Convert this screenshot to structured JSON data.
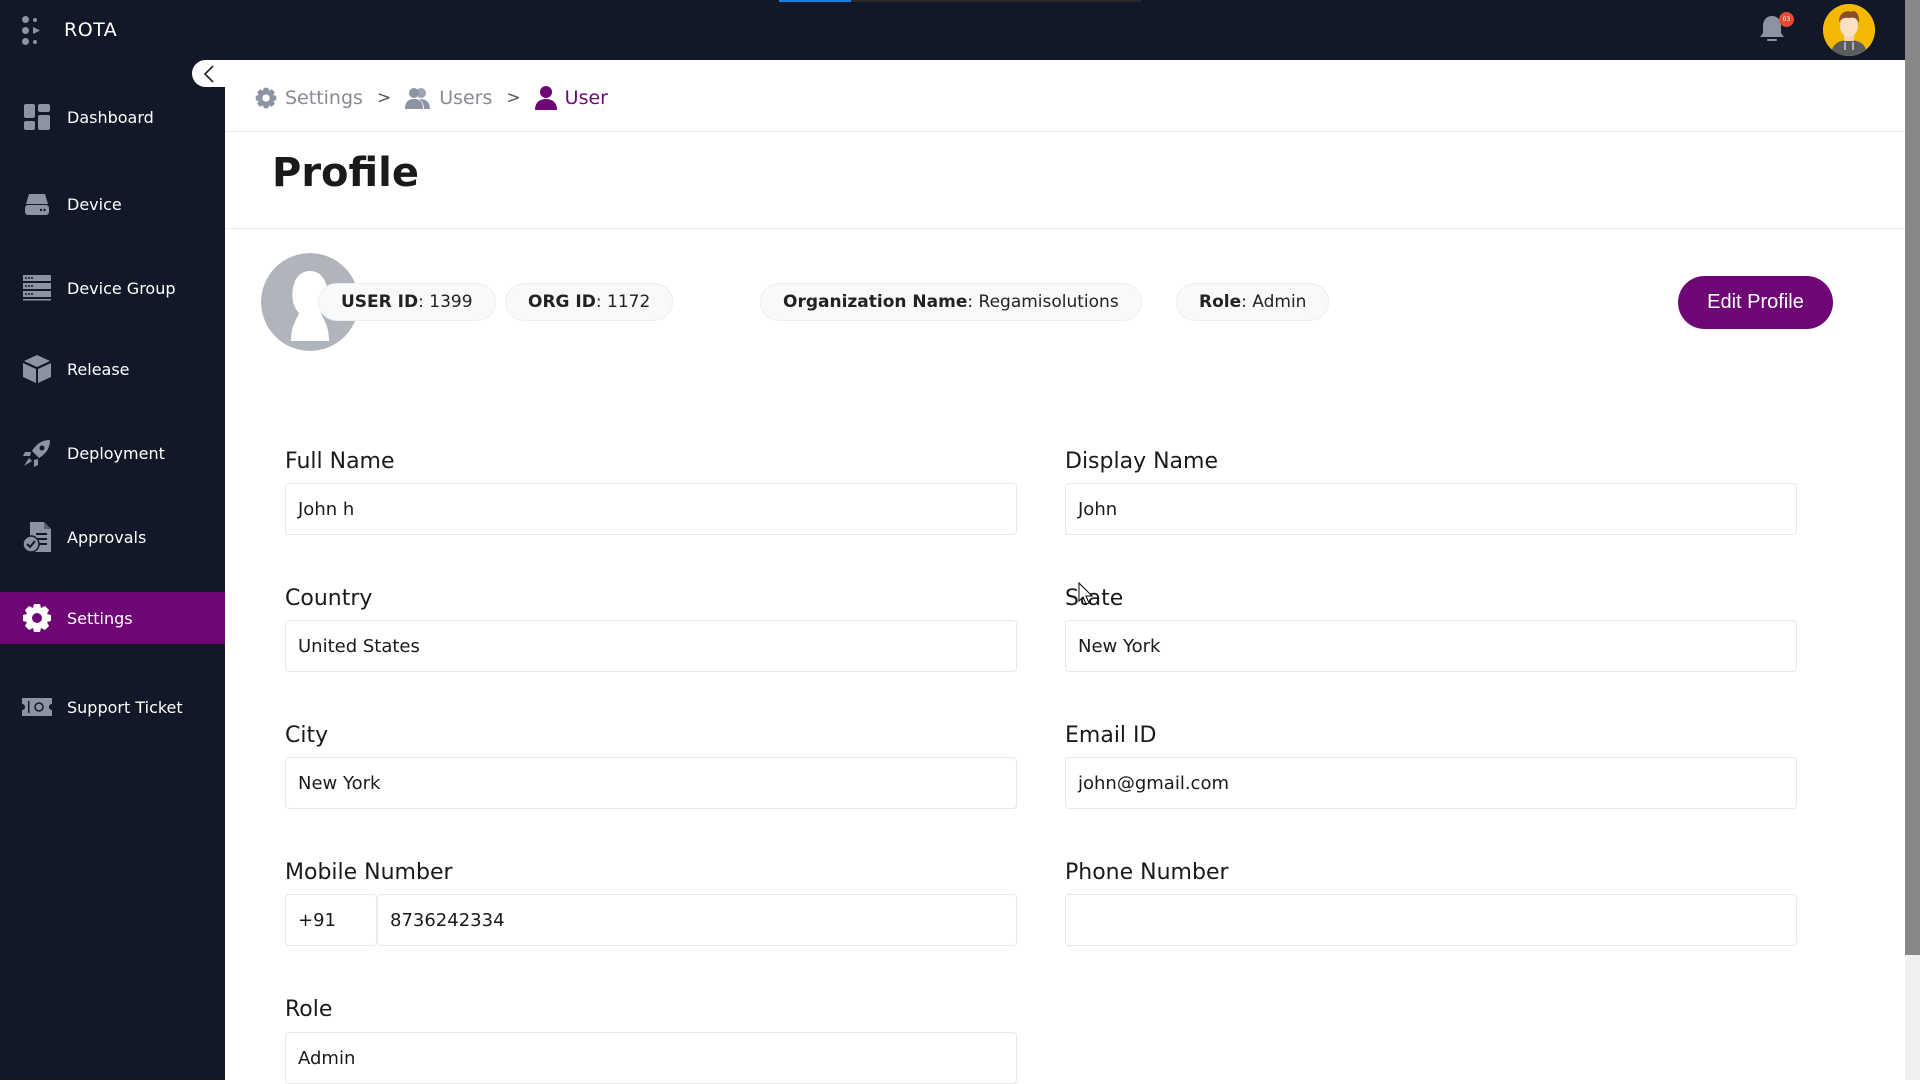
{
  "app": {
    "name": "ROTA",
    "notification_count": "03",
    "accent_color": "#6e0676"
  },
  "sidebar": {
    "items": [
      {
        "label": "Dashboard",
        "icon": "dashboard-icon",
        "active": false
      },
      {
        "label": "Device",
        "icon": "hard-drive-icon",
        "active": false
      },
      {
        "label": "Device Group",
        "icon": "server-rack-icon",
        "active": false
      },
      {
        "label": "Release",
        "icon": "package-box-icon",
        "active": false
      },
      {
        "label": "Deployment",
        "icon": "rocket-icon",
        "active": false
      },
      {
        "label": "Approvals",
        "icon": "document-check-icon",
        "active": false
      },
      {
        "label": "Settings",
        "icon": "gear-icon",
        "active": true
      },
      {
        "label": "Support Ticket",
        "icon": "ticket-icon",
        "active": false
      }
    ]
  },
  "breadcrumb": {
    "items": [
      {
        "label": "Settings",
        "icon": "gear-icon"
      },
      {
        "label": "Users",
        "icon": "users-icon"
      },
      {
        "label": "User",
        "icon": "user-icon"
      }
    ],
    "separator": ">"
  },
  "page": {
    "title": "Profile"
  },
  "profile": {
    "chips": [
      {
        "key": "USER ID",
        "value": "1399"
      },
      {
        "key": "ORG ID",
        "value": "1172"
      },
      {
        "key": "Organization Name",
        "value": "Regamisolutions"
      },
      {
        "key": "Role",
        "value": "Admin"
      }
    ],
    "edit_button": "Edit Profile"
  },
  "form": {
    "full_name": {
      "label": "Full Name",
      "value": "John h"
    },
    "display_name": {
      "label": "Display Name",
      "value": "John"
    },
    "country": {
      "label": "Country",
      "value": "United States"
    },
    "state": {
      "label": "State",
      "value": "New York"
    },
    "city": {
      "label": "City",
      "value": "New York"
    },
    "email": {
      "label": "Email ID",
      "value": "john@gmail.com"
    },
    "mobile": {
      "label": "Mobile Number",
      "country_code": "+91",
      "value": "8736242334"
    },
    "phone": {
      "label": "Phone Number",
      "value": ""
    },
    "role": {
      "label": "Role",
      "value": "Admin"
    }
  }
}
